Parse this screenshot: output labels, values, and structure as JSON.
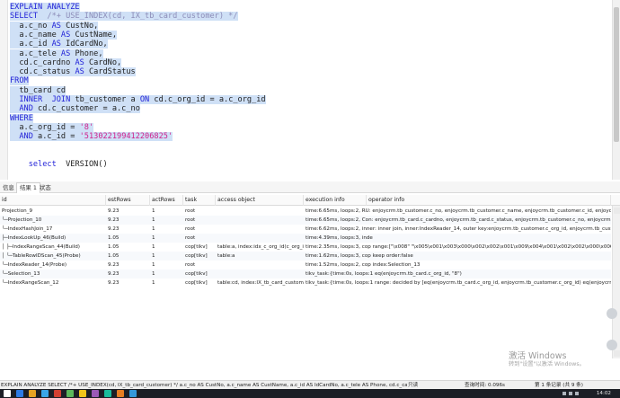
{
  "editor": {
    "lines": [
      {
        "segments": [
          {
            "t": "EXPLAIN ANALYZE",
            "c": "kw"
          }
        ],
        "hl": true
      },
      {
        "segments": [
          {
            "t": "SELECT  ",
            "c": "kw"
          },
          {
            "t": "/*+ USE_INDEX(cd, IX_tb_card_customer) */",
            "c": "cm"
          }
        ],
        "hl": true
      },
      {
        "segments": [
          {
            "t": "  a.c_no ",
            "c": "tx"
          },
          {
            "t": "AS",
            "c": "kw"
          },
          {
            "t": " CustNo,",
            "c": "tx"
          }
        ],
        "hl": true
      },
      {
        "segments": [
          {
            "t": "  a.c_name ",
            "c": "tx"
          },
          {
            "t": "AS",
            "c": "kw"
          },
          {
            "t": " CustName,",
            "c": "tx"
          }
        ],
        "hl": true
      },
      {
        "segments": [
          {
            "t": "  a.c_id ",
            "c": "tx"
          },
          {
            "t": "AS",
            "c": "kw"
          },
          {
            "t": " IdCardNo,",
            "c": "tx"
          }
        ],
        "hl": true
      },
      {
        "segments": [
          {
            "t": "  a.c_tele ",
            "c": "tx"
          },
          {
            "t": "AS",
            "c": "kw"
          },
          {
            "t": " Phone,",
            "c": "tx"
          }
        ],
        "hl": true
      },
      {
        "segments": [
          {
            "t": "  cd.c_cardno ",
            "c": "tx"
          },
          {
            "t": "AS",
            "c": "kw"
          },
          {
            "t": " CardNo,",
            "c": "tx"
          }
        ],
        "hl": true
      },
      {
        "segments": [
          {
            "t": "  cd.c_status ",
            "c": "tx"
          },
          {
            "t": "AS",
            "c": "kw"
          },
          {
            "t": " CardStatus",
            "c": "tx"
          }
        ],
        "hl": true
      },
      {
        "segments": [
          {
            "t": "FROM",
            "c": "kw"
          }
        ],
        "hl": true
      },
      {
        "segments": [
          {
            "t": "  tb_card cd",
            "c": "tx"
          }
        ],
        "hl": true
      },
      {
        "segments": [
          {
            "t": "  INNER  JOIN ",
            "c": "kw"
          },
          {
            "t": "tb_customer a ",
            "c": "tx"
          },
          {
            "t": "ON",
            "c": "kw"
          },
          {
            "t": " cd.c_org_id = a.c_org_id",
            "c": "tx"
          }
        ],
        "hl": true
      },
      {
        "segments": [
          {
            "t": "  AND",
            "c": "kw"
          },
          {
            "t": " cd.c_customer = a.c_no",
            "c": "tx"
          }
        ],
        "hl": true
      },
      {
        "segments": [
          {
            "t": "WHERE",
            "c": "kw"
          }
        ],
        "hl": true
      },
      {
        "segments": [
          {
            "t": "  a.c_org_id = ",
            "c": "tx"
          },
          {
            "t": "'8'",
            "c": "str"
          }
        ],
        "hl": true
      },
      {
        "segments": [
          {
            "t": "  AND",
            "c": "kw"
          },
          {
            "t": " a.c_id = ",
            "c": "tx"
          },
          {
            "t": "'513022199412206825'",
            "c": "str"
          }
        ],
        "hl": true
      },
      {
        "segments": [],
        "hl": false
      },
      {
        "segments": [],
        "hl": false
      },
      {
        "segments": [
          {
            "t": "    select  ",
            "c": "kw"
          },
          {
            "t": "VERSION()",
            "c": "tx"
          }
        ],
        "hl": false
      }
    ]
  },
  "tabs": [
    {
      "label": "信息",
      "active": false
    },
    {
      "label": "结果 1",
      "active": true
    },
    {
      "label": "状态",
      "active": false
    }
  ],
  "table": {
    "columns": [
      "id",
      "estRows",
      "actRows",
      "task",
      "access object",
      "execution info",
      "operator info"
    ],
    "rows": [
      [
        "Projection_9",
        "9.23",
        "1",
        "root",
        "",
        "time:6.65ms, loops:2, RU: enjoycrm.tb_customer.c_no, enjoycrm.tb_customer.c_name, enjoycrm.tb_customer.c_id, enjoycrm.tb_customer.c_tele",
        ""
      ],
      [
        "└─Projection_10",
        "9.23",
        "1",
        "root",
        "",
        "time:6.65ms, loops:2, Con: enjoycrm.tb_card.c_cardno, enjoycrm.tb_card.c_status, enjoycrm.tb_customer.c_no, enjoycrm.tb_customer.c_name",
        ""
      ],
      [
        "  └─IndexHashJoin_17",
        "9.23",
        "1",
        "root",
        "",
        "time:6.62ms, loops:2, inner: inner join, inner:IndexReader_14, outer key:enjoycrm.tb_customer.c_org_id, enjoycrm.tb_customer.c_no",
        ""
      ],
      [
        "    ├─IndexLookUp_46(Build)",
        "1.05",
        "1",
        "root",
        "",
        "time:4.39ms, loops:3, inde",
        ""
      ],
      [
        "    │ ├─IndexRangeScan_44(Build)",
        "1.05",
        "1",
        "cop[tikv]",
        "table:a, index:idx_c_org_id(c_org_id,",
        "time:2.35ms, loops:3, cop range:[\"\\x008\" \"\\x005\\x001\\x003\\x000\\x002\\x002\\x001\\x009\\x004\\x001\\x002\\x002\\x000\\x006\\x008\\x002\\x005\"",
        ""
      ],
      [
        "    │ └─TableRowIDScan_45(Probe)",
        "1.05",
        "1",
        "cop[tikv]",
        "table:a",
        "time:1.62ms, loops:3, cop keep order:false",
        ""
      ],
      [
        "    └─IndexReader_14(Probe)",
        "9.23",
        "1",
        "root",
        "",
        "time:1.52ms, loops:2, cop index:Selection_13",
        ""
      ],
      [
        "      └─Selection_13",
        "9.23",
        "1",
        "cop[tikv]",
        "",
        "tikv_task:{time:0s, loops:1 eq(enjoycrm.tb_card.c_org_id, \"8\")",
        ""
      ],
      [
        "        └─IndexRangeScan_12",
        "9.23",
        "1",
        "cop[tikv]",
        "table:cd, index:IX_tb_card_customer(",
        "tikv_task:{time:0s, loops:1 range: decided by [eq(enjoycrm.tb_card.c_org_id, enjoycrm.tb_customer.c_org_id) eq(enjoycrm.tb_card.c_customer",
        ""
      ]
    ]
  },
  "watermark": {
    "line1": "激活 Windows",
    "line2": "转到\"设置\"以激活 Windows。"
  },
  "status": {
    "query": "EXPLAIN ANALYZE SELECT  /*+ USE_INDEX(cd, IX_tb_card_customer) */   a.c_no AS CustNo,   a.c_name AS CustName,   a.c_id AS IdCardNo,   a.c_tele AS Phone,   cd.c_cardno AS Carc",
    "mode": "只读",
    "query_time": "查询时间: 0.096s",
    "record": "第 1 条记录 (共 9 条)"
  },
  "taskbar": {
    "clock": "14:02",
    "icon_colors": [
      "#ffffff",
      "#2d7be5",
      "#e4a224",
      "#3aa5e8",
      "#d23f31",
      "#5cb85c",
      "#f0c419",
      "#9b59b6",
      "#1abc9c",
      "#e67e22",
      "#3498db"
    ]
  }
}
